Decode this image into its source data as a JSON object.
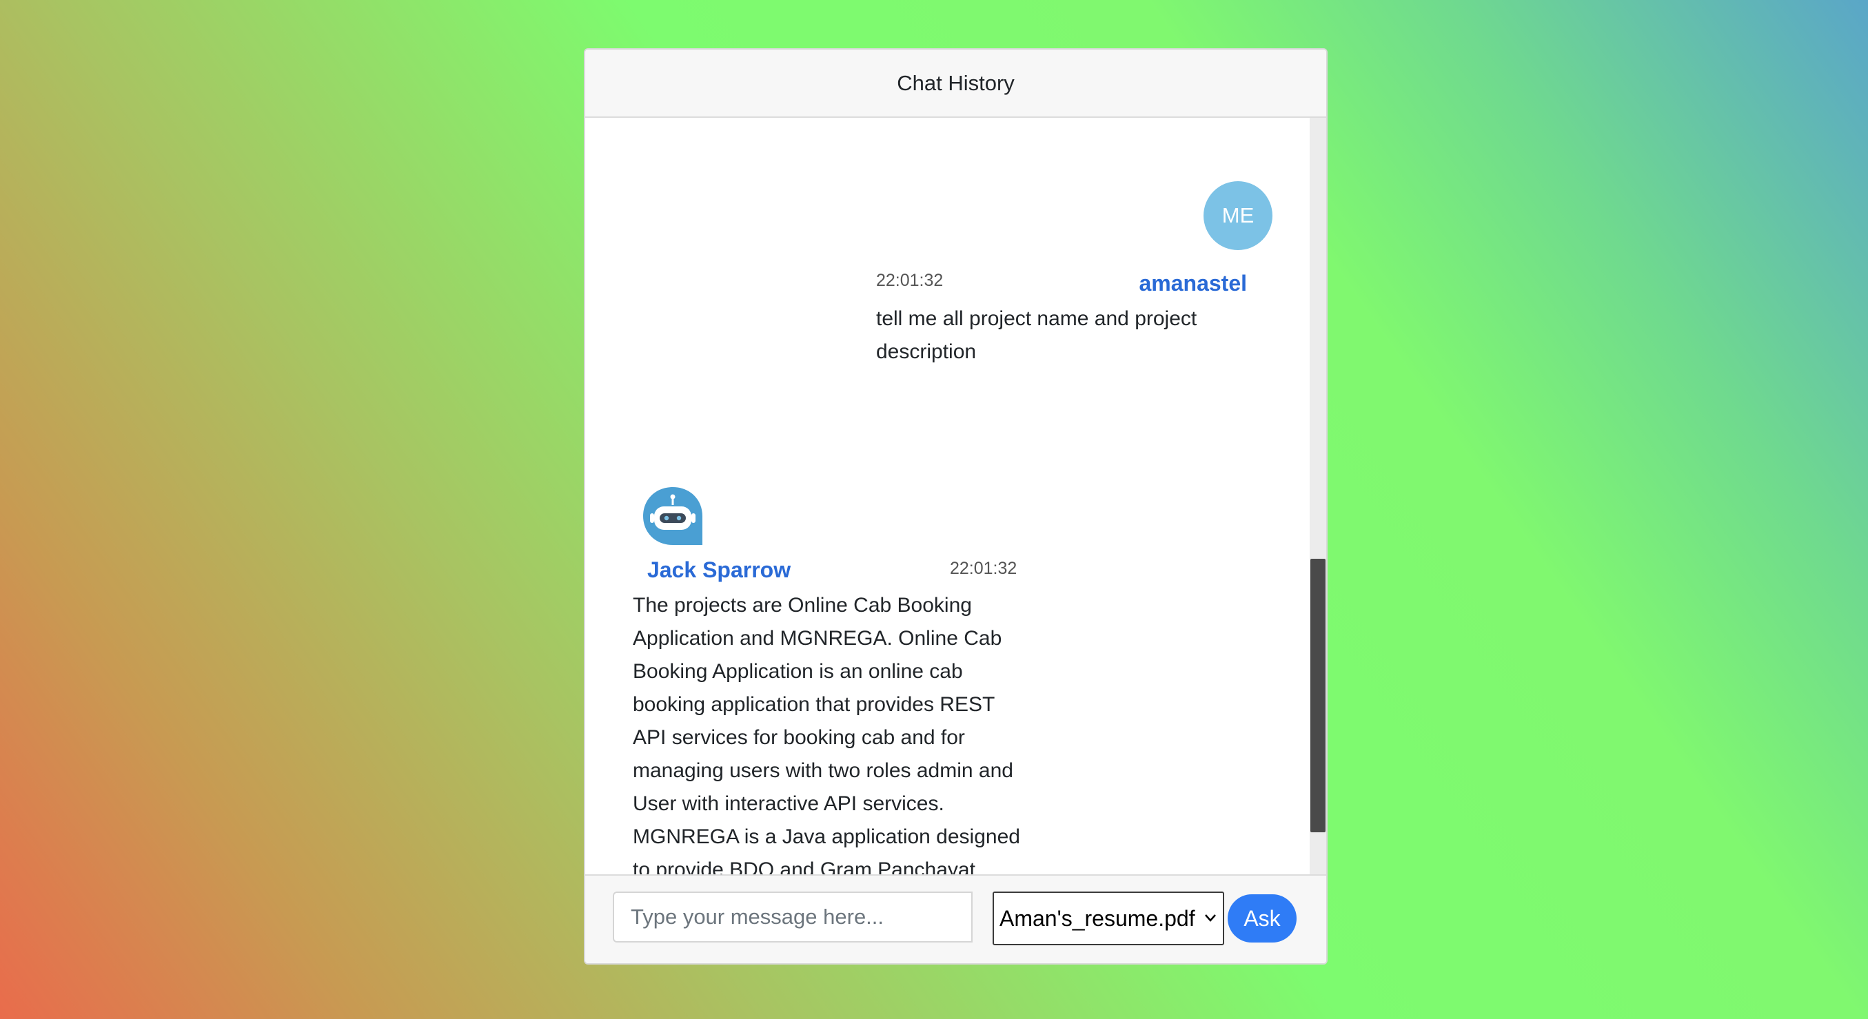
{
  "header": {
    "title": "Chat History"
  },
  "messages": [
    {
      "sender": "amanastel",
      "avatar_text": "ME",
      "time": "22:01:32",
      "text": "tell me all project name and project description"
    },
    {
      "sender": "Jack Sparrow",
      "avatar_icon": "robot-chat-icon",
      "time": "22:01:32",
      "text": "The projects are Online Cab Booking Application and MGNREGA. Online Cab Booking Application is an online cab booking application that provides REST API services for booking cab and for managing users with two roles admin and User with interactive API services. MGNREGA is a Java application designed to provide BDO and Gram Panchayat Member (GPM) of Block Office with a"
    }
  ],
  "footer": {
    "input_placeholder": "Type your message here...",
    "input_value": "",
    "selected_file": "Aman's_resume.pdf",
    "ask_label": "Ask"
  },
  "colors": {
    "accent": "#2f7cf6",
    "name": "#2a6ad6",
    "me_avatar": "#7cc2e6",
    "bot_avatar": "#4a9fd3"
  }
}
